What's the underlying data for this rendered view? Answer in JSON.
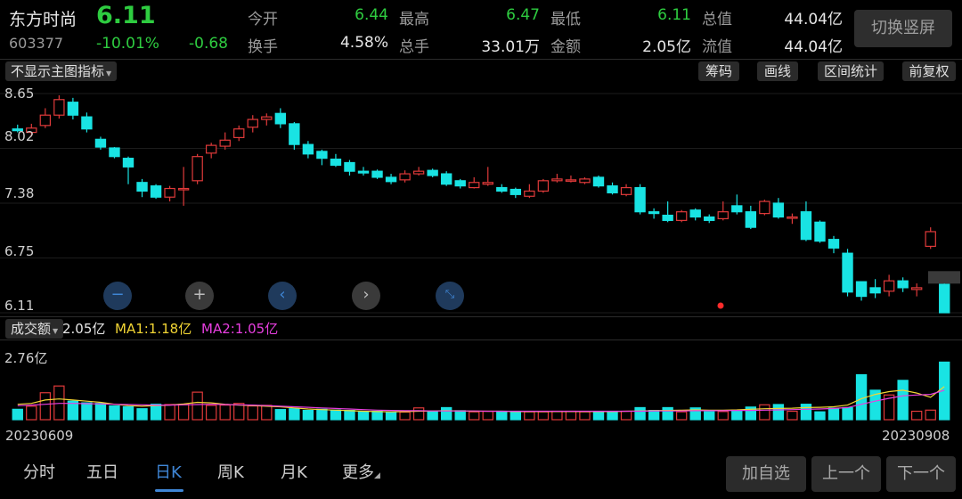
{
  "header": {
    "name": "东方时尚",
    "price": "6.11",
    "code": "603377",
    "pct": "-10.01%",
    "change": "-0.68",
    "stats": [
      {
        "label": "今开",
        "value": "6.44",
        "green": true
      },
      {
        "label": "最高",
        "value": "6.47",
        "green": true
      },
      {
        "label": "最低",
        "value": "6.11",
        "green": true
      },
      {
        "label": "总值",
        "value": "44.04亿",
        "green": false
      },
      {
        "label": "换手",
        "value": "4.58%",
        "green": false
      },
      {
        "label": "总手",
        "value": "33.01万",
        "green": false
      },
      {
        "label": "金额",
        "value": "2.05亿",
        "green": false
      },
      {
        "label": "流值",
        "value": "44.04亿",
        "green": false
      }
    ],
    "switch_label": "切换竖屏"
  },
  "toolbar": {
    "indicator_select": "不显示主图指标",
    "buttons": [
      "筹码",
      "画线",
      "区间统计",
      "前复权"
    ]
  },
  "price_axis": [
    "8.65",
    "8.02",
    "7.38",
    "6.75",
    "6.11"
  ],
  "volume": {
    "select": "成交额",
    "current": "2.05亿",
    "ma1_label": "MA1:1.18亿",
    "ma2_label": "MA2:1.05亿",
    "axis_top": "2.76亿"
  },
  "dates": {
    "start": "20230609",
    "end": "20230908"
  },
  "nav_icons": [
    "zoom-out-icon",
    "zoom-in-icon",
    "scroll-left-icon",
    "scroll-right-icon",
    "collapse-icon"
  ],
  "tabs": [
    {
      "label": "分时"
    },
    {
      "label": "五日"
    },
    {
      "label": "日K"
    },
    {
      "label": "周K"
    },
    {
      "label": "月K"
    },
    {
      "label": "更多"
    }
  ],
  "bottom_buttons": [
    "加自选",
    "上一个",
    "下一个"
  ],
  "colors": {
    "up": "#e03a3a",
    "down": "#19e3e3",
    "green": "#2ecc40",
    "accent": "#3f86d6",
    "ma1": "#f2d534",
    "ma2": "#e83ee0"
  },
  "chart_data": {
    "type": "candlestick",
    "x_start": "20230609",
    "x_end": "20230908",
    "ylim": [
      6.11,
      8.65
    ],
    "candles": [
      [
        8.24,
        8.22,
        8.29,
        8.2
      ],
      [
        8.2,
        8.25,
        8.3,
        8.15
      ],
      [
        8.28,
        8.4,
        8.48,
        8.25
      ],
      [
        8.4,
        8.58,
        8.63,
        8.36
      ],
      [
        8.55,
        8.4,
        8.6,
        8.35
      ],
      [
        8.38,
        8.24,
        8.43,
        8.2
      ],
      [
        8.12,
        8.03,
        8.15,
        8.0
      ],
      [
        8.02,
        7.92,
        8.03,
        7.9
      ],
      [
        7.9,
        7.8,
        7.92,
        7.6
      ],
      [
        7.62,
        7.52,
        7.66,
        7.45
      ],
      [
        7.58,
        7.45,
        7.6,
        7.43
      ],
      [
        7.45,
        7.55,
        7.58,
        7.4
      ],
      [
        7.54,
        7.55,
        7.8,
        7.35
      ],
      [
        7.64,
        7.92,
        7.95,
        7.6
      ],
      [
        7.96,
        8.05,
        8.08,
        7.9
      ],
      [
        8.04,
        8.11,
        8.2,
        8.0
      ],
      [
        8.14,
        8.24,
        8.28,
        8.1
      ],
      [
        8.26,
        8.35,
        8.4,
        8.2
      ],
      [
        8.35,
        8.38,
        8.42,
        8.28
      ],
      [
        8.42,
        8.3,
        8.48,
        8.25
      ],
      [
        8.3,
        8.06,
        8.32,
        8.0
      ],
      [
        8.06,
        7.95,
        8.1,
        7.9
      ],
      [
        7.98,
        7.9,
        8.0,
        7.82
      ],
      [
        7.89,
        7.82,
        7.95,
        7.8
      ],
      [
        7.85,
        7.75,
        7.88,
        7.7
      ],
      [
        7.75,
        7.73,
        7.8,
        7.7
      ],
      [
        7.75,
        7.68,
        7.77,
        7.66
      ],
      [
        7.68,
        7.63,
        7.72,
        7.6
      ],
      [
        7.65,
        7.72,
        7.76,
        7.62
      ],
      [
        7.72,
        7.75,
        7.8,
        7.7
      ],
      [
        7.76,
        7.7,
        7.78,
        7.68
      ],
      [
        7.72,
        7.6,
        7.75,
        7.58
      ],
      [
        7.64,
        7.58,
        7.66,
        7.55
      ],
      [
        7.56,
        7.62,
        7.68,
        7.55
      ],
      [
        7.6,
        7.62,
        7.8,
        7.58
      ],
      [
        7.56,
        7.52,
        7.6,
        7.5
      ],
      [
        7.54,
        7.48,
        7.56,
        7.44
      ],
      [
        7.46,
        7.52,
        7.6,
        7.44
      ],
      [
        7.52,
        7.64,
        7.66,
        7.5
      ],
      [
        7.64,
        7.66,
        7.72,
        7.62
      ],
      [
        7.65,
        7.65,
        7.7,
        7.62
      ],
      [
        7.62,
        7.66,
        7.68,
        7.6
      ],
      [
        7.68,
        7.58,
        7.7,
        7.56
      ],
      [
        7.58,
        7.5,
        7.62,
        7.48
      ],
      [
        7.48,
        7.56,
        7.6,
        7.46
      ],
      [
        7.56,
        7.28,
        7.6,
        7.25
      ],
      [
        7.28,
        7.26,
        7.32,
        7.2
      ],
      [
        7.24,
        7.18,
        7.4,
        7.16
      ],
      [
        7.18,
        7.28,
        7.3,
        7.16
      ],
      [
        7.3,
        7.22,
        7.32,
        7.18
      ],
      [
        7.22,
        7.18,
        7.25,
        7.15
      ],
      [
        7.2,
        7.28,
        7.4,
        7.18
      ],
      [
        7.35,
        7.28,
        7.48,
        7.25
      ],
      [
        7.28,
        7.1,
        7.35,
        7.08
      ],
      [
        7.26,
        7.4,
        7.42,
        7.24
      ],
      [
        7.38,
        7.22,
        7.44,
        7.2
      ],
      [
        7.22,
        7.22,
        7.26,
        7.14
      ],
      [
        7.28,
        6.96,
        7.4,
        6.94
      ],
      [
        7.16,
        6.94,
        7.18,
        6.92
      ],
      [
        6.96,
        6.86,
        7.0,
        6.8
      ],
      [
        6.8,
        6.35,
        6.85,
        6.3
      ],
      [
        6.47,
        6.3,
        6.47,
        6.25
      ],
      [
        6.4,
        6.34,
        6.5,
        6.28
      ],
      [
        6.36,
        6.48,
        6.55,
        6.3
      ],
      [
        6.48,
        6.4,
        6.52,
        6.35
      ],
      [
        6.38,
        6.4,
        6.45,
        6.3
      ],
      [
        6.88,
        7.05,
        7.1,
        6.85
      ],
      [
        6.44,
        6.11,
        6.47,
        6.11
      ]
    ],
    "vol_ylim": [
      0,
      2.76
    ],
    "volume_yi": [
      0.37,
      0.48,
      0.96,
      1.2,
      0.66,
      0.6,
      0.58,
      0.49,
      0.46,
      0.39,
      0.55,
      0.54,
      0.55,
      0.98,
      0.51,
      0.52,
      0.58,
      0.49,
      0.51,
      0.36,
      0.39,
      0.33,
      0.37,
      0.34,
      0.33,
      0.28,
      0.3,
      0.25,
      0.27,
      0.42,
      0.29,
      0.43,
      0.32,
      0.28,
      0.3,
      0.3,
      0.29,
      0.28,
      0.28,
      0.3,
      0.3,
      0.28,
      0.28,
      0.28,
      0.3,
      0.43,
      0.33,
      0.43,
      0.28,
      0.42,
      0.28,
      0.29,
      0.3,
      0.45,
      0.53,
      0.54,
      0.3,
      0.55,
      0.28,
      0.41,
      0.43,
      1.6,
      1.05,
      0.88,
      1.4,
      0.3,
      0.34,
      2.05
    ],
    "ma1": [
      0.55,
      0.58,
      0.7,
      0.74,
      0.7,
      0.66,
      0.62,
      0.55,
      0.5,
      0.48,
      0.5,
      0.52,
      0.56,
      0.62,
      0.6,
      0.55,
      0.52,
      0.5,
      0.48,
      0.46,
      0.42,
      0.38,
      0.36,
      0.34,
      0.32,
      0.3,
      0.29,
      0.28,
      0.29,
      0.3,
      0.31,
      0.32,
      0.31,
      0.3,
      0.3,
      0.3,
      0.29,
      0.29,
      0.29,
      0.29,
      0.29,
      0.29,
      0.29,
      0.29,
      0.3,
      0.31,
      0.32,
      0.33,
      0.34,
      0.35,
      0.34,
      0.34,
      0.35,
      0.37,
      0.39,
      0.4,
      0.41,
      0.43,
      0.44,
      0.46,
      0.52,
      0.75,
      0.9,
      1.0,
      1.05,
      0.95,
      0.8,
      1.18
    ],
    "ma2": [
      0.5,
      0.52,
      0.55,
      0.58,
      0.58,
      0.57,
      0.56,
      0.55,
      0.54,
      0.53,
      0.52,
      0.52,
      0.53,
      0.54,
      0.55,
      0.54,
      0.53,
      0.52,
      0.5,
      0.48,
      0.46,
      0.44,
      0.42,
      0.4,
      0.38,
      0.36,
      0.34,
      0.33,
      0.32,
      0.32,
      0.31,
      0.31,
      0.31,
      0.31,
      0.3,
      0.3,
      0.3,
      0.3,
      0.3,
      0.3,
      0.3,
      0.3,
      0.3,
      0.3,
      0.3,
      0.3,
      0.31,
      0.31,
      0.31,
      0.32,
      0.32,
      0.32,
      0.33,
      0.33,
      0.34,
      0.35,
      0.36,
      0.37,
      0.38,
      0.4,
      0.43,
      0.55,
      0.66,
      0.76,
      0.85,
      0.88,
      0.9,
      1.05
    ]
  }
}
